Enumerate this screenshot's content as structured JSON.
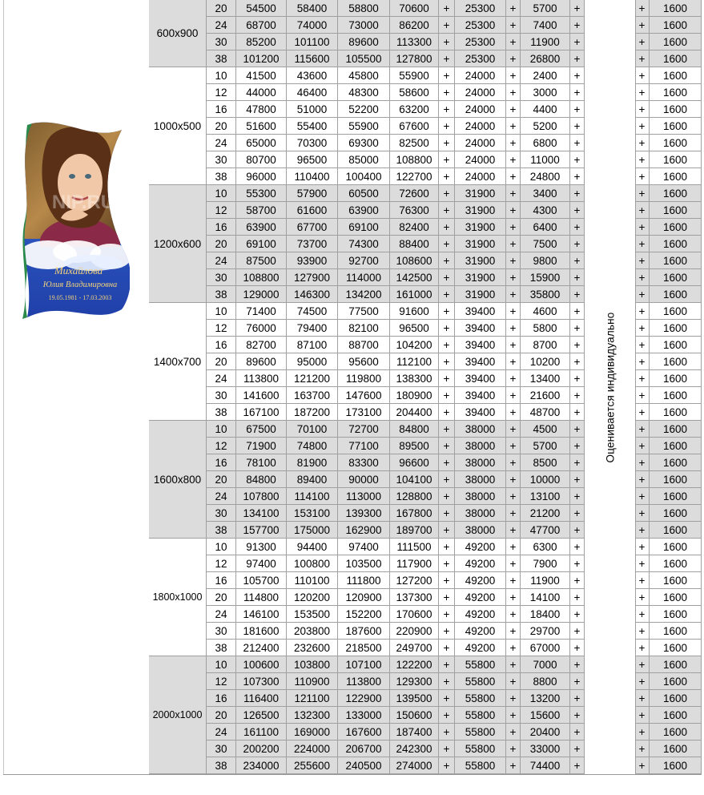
{
  "plaque": {
    "watermark": "NIP.RU",
    "name_line1": "Михайлова",
    "name_line2": "Юлия Владимировна",
    "dates": "19.05.1981 - 17.03.2003"
  },
  "note_text": "Оценивается индивидуально",
  "plus_mark": "+",
  "last_value": "1600",
  "groups": [
    {
      "size": "600x900",
      "rows": [
        {
          "t": "20",
          "v1": "54500",
          "v2": "58400",
          "v3": "58800",
          "v4": "70600",
          "v5": "25300",
          "v6": "5700"
        },
        {
          "t": "24",
          "v1": "68700",
          "v2": "74000",
          "v3": "73000",
          "v4": "86200",
          "v5": "25300",
          "v6": "7400"
        },
        {
          "t": "30",
          "v1": "85200",
          "v2": "101100",
          "v3": "89600",
          "v4": "113300",
          "v5": "25300",
          "v6": "11900"
        },
        {
          "t": "38",
          "v1": "101200",
          "v2": "115600",
          "v3": "105500",
          "v4": "127800",
          "v5": "25300",
          "v6": "26800"
        }
      ]
    },
    {
      "size": "1000x500",
      "rows": [
        {
          "t": "10",
          "v1": "41500",
          "v2": "43600",
          "v3": "45800",
          "v4": "55900",
          "v5": "24000",
          "v6": "2400"
        },
        {
          "t": "12",
          "v1": "44000",
          "v2": "46400",
          "v3": "48300",
          "v4": "58600",
          "v5": "24000",
          "v6": "3000"
        },
        {
          "t": "16",
          "v1": "47800",
          "v2": "51000",
          "v3": "52200",
          "v4": "63200",
          "v5": "24000",
          "v6": "4400"
        },
        {
          "t": "20",
          "v1": "51600",
          "v2": "55400",
          "v3": "55900",
          "v4": "67600",
          "v5": "24000",
          "v6": "5200"
        },
        {
          "t": "24",
          "v1": "65000",
          "v2": "70300",
          "v3": "69300",
          "v4": "82500",
          "v5": "24000",
          "v6": "6800"
        },
        {
          "t": "30",
          "v1": "80700",
          "v2": "96500",
          "v3": "85000",
          "v4": "108800",
          "v5": "24000",
          "v6": "11000"
        },
        {
          "t": "38",
          "v1": "96000",
          "v2": "110400",
          "v3": "100400",
          "v4": "122700",
          "v5": "24000",
          "v6": "24800"
        }
      ]
    },
    {
      "size": "1200x600",
      "rows": [
        {
          "t": "10",
          "v1": "55300",
          "v2": "57900",
          "v3": "60500",
          "v4": "72600",
          "v5": "31900",
          "v6": "3400"
        },
        {
          "t": "12",
          "v1": "58700",
          "v2": "61600",
          "v3": "63900",
          "v4": "76300",
          "v5": "31900",
          "v6": "4300"
        },
        {
          "t": "16",
          "v1": "63900",
          "v2": "67700",
          "v3": "69100",
          "v4": "82400",
          "v5": "31900",
          "v6": "6400"
        },
        {
          "t": "20",
          "v1": "69100",
          "v2": "73700",
          "v3": "74300",
          "v4": "88400",
          "v5": "31900",
          "v6": "7500"
        },
        {
          "t": "24",
          "v1": "87500",
          "v2": "93900",
          "v3": "92700",
          "v4": "108600",
          "v5": "31900",
          "v6": "9800"
        },
        {
          "t": "30",
          "v1": "108800",
          "v2": "127900",
          "v3": "114000",
          "v4": "142500",
          "v5": "31900",
          "v6": "15900"
        },
        {
          "t": "38",
          "v1": "129000",
          "v2": "146300",
          "v3": "134200",
          "v4": "161000",
          "v5": "31900",
          "v6": "35800"
        }
      ]
    },
    {
      "size": "1400x700",
      "rows": [
        {
          "t": "10",
          "v1": "71400",
          "v2": "74500",
          "v3": "77500",
          "v4": "91600",
          "v5": "39400",
          "v6": "4600"
        },
        {
          "t": "12",
          "v1": "76000",
          "v2": "79400",
          "v3": "82100",
          "v4": "96500",
          "v5": "39400",
          "v6": "5800"
        },
        {
          "t": "16",
          "v1": "82700",
          "v2": "87100",
          "v3": "88700",
          "v4": "104200",
          "v5": "39400",
          "v6": "8700"
        },
        {
          "t": "20",
          "v1": "89600",
          "v2": "95000",
          "v3": "95600",
          "v4": "112100",
          "v5": "39400",
          "v6": "10200"
        },
        {
          "t": "24",
          "v1": "113800",
          "v2": "121200",
          "v3": "119800",
          "v4": "138300",
          "v5": "39400",
          "v6": "13400"
        },
        {
          "t": "30",
          "v1": "141600",
          "v2": "163700",
          "v3": "147600",
          "v4": "180900",
          "v5": "39400",
          "v6": "21600"
        },
        {
          "t": "38",
          "v1": "167100",
          "v2": "187200",
          "v3": "173100",
          "v4": "204400",
          "v5": "39400",
          "v6": "48700"
        }
      ]
    },
    {
      "size": "1600x800",
      "rows": [
        {
          "t": "10",
          "v1": "67500",
          "v2": "70100",
          "v3": "72700",
          "v4": "84800",
          "v5": "38000",
          "v6": "4500"
        },
        {
          "t": "12",
          "v1": "71900",
          "v2": "74800",
          "v3": "77100",
          "v4": "89500",
          "v5": "38000",
          "v6": "5700"
        },
        {
          "t": "16",
          "v1": "78100",
          "v2": "81900",
          "v3": "83300",
          "v4": "96600",
          "v5": "38000",
          "v6": "8500"
        },
        {
          "t": "20",
          "v1": "84800",
          "v2": "89400",
          "v3": "90000",
          "v4": "104100",
          "v5": "38000",
          "v6": "10000"
        },
        {
          "t": "24",
          "v1": "107800",
          "v2": "114100",
          "v3": "113000",
          "v4": "128800",
          "v5": "38000",
          "v6": "13100"
        },
        {
          "t": "30",
          "v1": "134100",
          "v2": "153100",
          "v3": "139300",
          "v4": "167800",
          "v5": "38000",
          "v6": "21200"
        },
        {
          "t": "38",
          "v1": "157700",
          "v2": "175000",
          "v3": "162900",
          "v4": "189700",
          "v5": "38000",
          "v6": "47700"
        }
      ]
    },
    {
      "size": "1800x1000",
      "rows": [
        {
          "t": "10",
          "v1": "91300",
          "v2": "94400",
          "v3": "97400",
          "v4": "111500",
          "v5": "49200",
          "v6": "6300"
        },
        {
          "t": "12",
          "v1": "97400",
          "v2": "100800",
          "v3": "103500",
          "v4": "117900",
          "v5": "49200",
          "v6": "7900"
        },
        {
          "t": "16",
          "v1": "105700",
          "v2": "110100",
          "v3": "111800",
          "v4": "127200",
          "v5": "49200",
          "v6": "11900"
        },
        {
          "t": "20",
          "v1": "114800",
          "v2": "120200",
          "v3": "120900",
          "v4": "137300",
          "v5": "49200",
          "v6": "14100"
        },
        {
          "t": "24",
          "v1": "146100",
          "v2": "153500",
          "v3": "152200",
          "v4": "170600",
          "v5": "49200",
          "v6": "18400"
        },
        {
          "t": "30",
          "v1": "181600",
          "v2": "203800",
          "v3": "187600",
          "v4": "220900",
          "v5": "49200",
          "v6": "29700"
        },
        {
          "t": "38",
          "v1": "212400",
          "v2": "232600",
          "v3": "218500",
          "v4": "249700",
          "v5": "49200",
          "v6": "67000"
        }
      ]
    },
    {
      "size": "2000x1000",
      "rows": [
        {
          "t": "10",
          "v1": "100600",
          "v2": "103800",
          "v3": "107100",
          "v4": "122200",
          "v5": "55800",
          "v6": "7000"
        },
        {
          "t": "12",
          "v1": "107300",
          "v2": "110900",
          "v3": "113800",
          "v4": "129300",
          "v5": "55800",
          "v6": "8800"
        },
        {
          "t": "16",
          "v1": "116400",
          "v2": "121100",
          "v3": "122900",
          "v4": "139500",
          "v5": "55800",
          "v6": "13200"
        },
        {
          "t": "20",
          "v1": "126500",
          "v2": "132300",
          "v3": "133000",
          "v4": "150600",
          "v5": "55800",
          "v6": "15600"
        },
        {
          "t": "24",
          "v1": "161100",
          "v2": "169000",
          "v3": "167600",
          "v4": "187400",
          "v5": "55800",
          "v6": "20400"
        },
        {
          "t": "30",
          "v1": "200200",
          "v2": "224000",
          "v3": "206700",
          "v4": "242300",
          "v5": "55800",
          "v6": "33000"
        },
        {
          "t": "38",
          "v1": "234000",
          "v2": "255600",
          "v3": "240500",
          "v4": "274000",
          "v5": "55800",
          "v6": "74400"
        }
      ]
    }
  ]
}
